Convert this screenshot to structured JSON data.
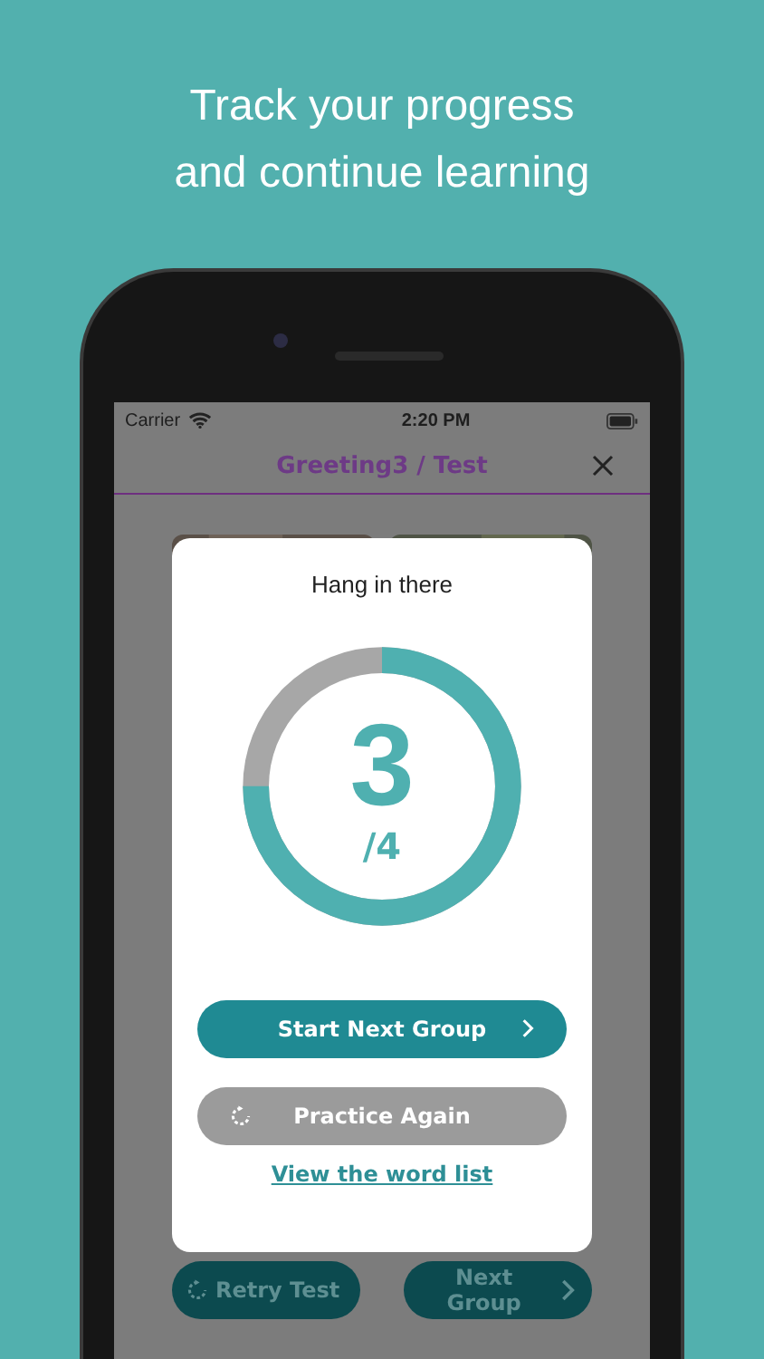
{
  "headline": [
    "Track your progress",
    "and continue learning"
  ],
  "status_bar": {
    "carrier": "Carrier",
    "time": "2:20 PM"
  },
  "nav": {
    "title": "Greeting3 / Test"
  },
  "dialog": {
    "title": "Hang in there",
    "score": "3",
    "total": "/4",
    "level": 0.75,
    "buttons": [
      {
        "kind": "primary",
        "label": "Start Next Group"
      },
      {
        "kind": "secondary",
        "label": "Practice Again"
      }
    ],
    "link": "View the word list"
  },
  "bottom_buttons": [
    {
      "kind": "retry",
      "label": "Retry Test"
    },
    {
      "kind": "next",
      "label": "Next Group"
    }
  ]
}
